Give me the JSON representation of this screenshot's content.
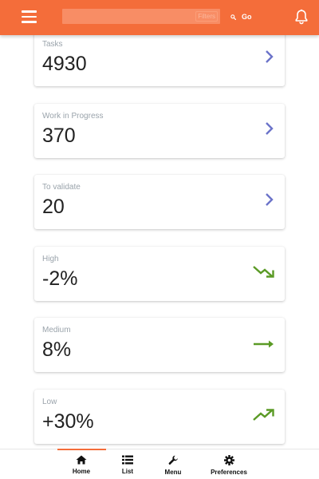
{
  "header": {
    "search": {
      "value": "",
      "filters_label": "Filters"
    },
    "go_label": "Go",
    "accent_color": "#f46d3a"
  },
  "cards": [
    {
      "label": "Tasks",
      "value": "4930",
      "icon": "chevron-right-icon"
    },
    {
      "label": "Work in Progress",
      "value": "370",
      "icon": "chevron-right-icon"
    },
    {
      "label": "To validate",
      "value": "20",
      "icon": "chevron-right-icon"
    },
    {
      "label": "High",
      "value": "-2%",
      "icon": "trending-down-icon"
    },
    {
      "label": "Medium",
      "value": "8%",
      "icon": "trending-flat-icon"
    },
    {
      "label": "Low",
      "value": "+30%",
      "icon": "trending-up-icon"
    }
  ],
  "colors": {
    "chevron": "#6b73c9",
    "trend": "#5a9a25"
  },
  "bottom_nav": {
    "active": "Home",
    "items": [
      {
        "label": "Home",
        "icon": "home-icon"
      },
      {
        "label": "List",
        "icon": "list-icon"
      },
      {
        "label": "Menu",
        "icon": "wrench-icon"
      },
      {
        "label": "Preferences",
        "icon": "gear-icon"
      }
    ]
  }
}
